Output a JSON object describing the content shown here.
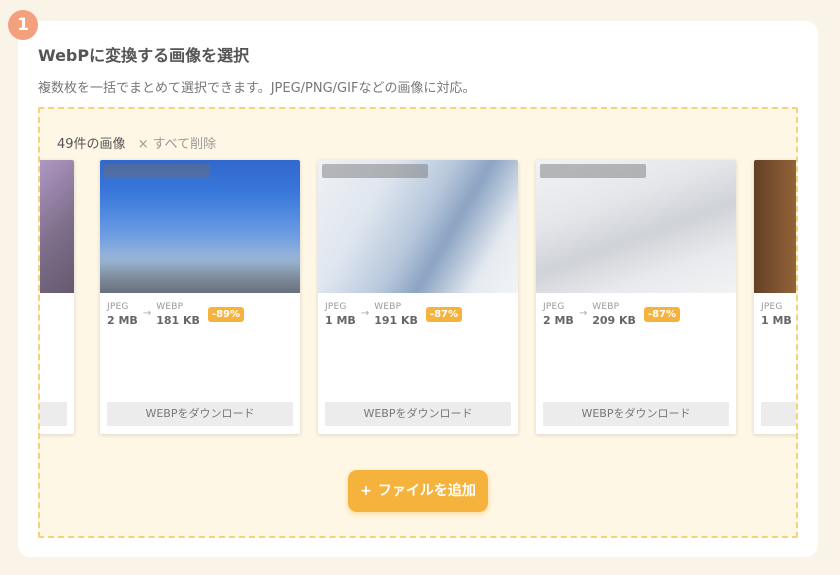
{
  "step": {
    "number": "1"
  },
  "panel": {
    "title": "WebPに変換する画像を選択",
    "description": "複数枚を一括でまとめて選択できます。JPEG/PNG/GIFなどの画像に対応。"
  },
  "dropzone": {
    "count_label": "49件の画像",
    "clear_icon": "×",
    "clear_label": "すべて削除",
    "add_icon": "+",
    "add_label": "ファイルを追加"
  },
  "cards": [
    {
      "from_format": "",
      "from_size": "",
      "to_format": "",
      "to_size": "",
      "saving": "",
      "download_label": ""
    },
    {
      "from_format": "JPEG",
      "from_size": "2 MB",
      "to_format": "WEBP",
      "to_size": "181 KB",
      "saving": "-89%",
      "download_label": "WEBPをダウンロード"
    },
    {
      "from_format": "JPEG",
      "from_size": "1 MB",
      "to_format": "WEBP",
      "to_size": "191 KB",
      "saving": "-87%",
      "download_label": "WEBPをダウンロード"
    },
    {
      "from_format": "JPEG",
      "from_size": "2 MB",
      "to_format": "WEBP",
      "to_size": "209 KB",
      "saving": "-87%",
      "download_label": "WEBPをダウンロード"
    },
    {
      "from_format": "JPEG",
      "from_size": "1 MB",
      "to_format": "",
      "to_size": "",
      "saving": "",
      "download_label": ""
    }
  ],
  "colors": {
    "accent": "#f5b33e",
    "step_badge": "#f3a17c",
    "dropzone_bg": "#fff7e5",
    "dropzone_border": "#f4d27a"
  },
  "icons": {
    "arrow": "→"
  }
}
